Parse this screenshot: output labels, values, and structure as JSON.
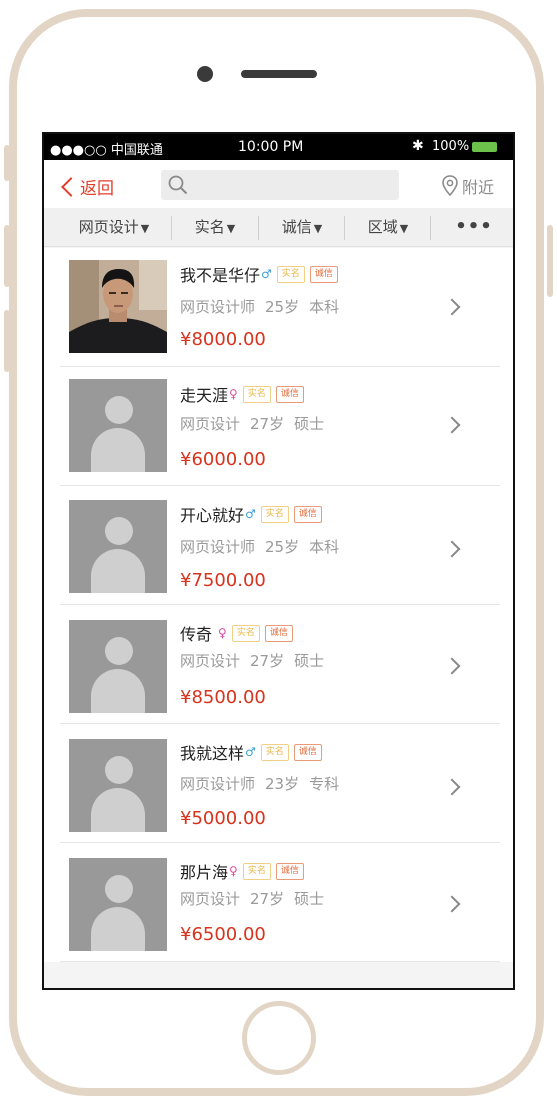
{
  "status_bar": {
    "carrier": "●●●○○ 中国联通",
    "time": "10:00 PM",
    "bluetooth": "bluetooth-icon",
    "battery": "100%",
    "battery_level": 1.0,
    "battery_color": "#6cc24a"
  },
  "nav": {
    "back_label": "返回",
    "search_placeholder": "",
    "nearby_label": "附近"
  },
  "filters": [
    {
      "label": "网页设计"
    },
    {
      "label": "实名"
    },
    {
      "label": "诚信"
    },
    {
      "label": "区域"
    }
  ],
  "more_label": "•••",
  "badges": {
    "real": "实名",
    "credit": "诚信"
  },
  "items": [
    {
      "name": "我不是华仔",
      "gender": "♂",
      "gender_type": "male",
      "job": "网页设计师",
      "age": "25岁",
      "edu": "本科",
      "price": "¥8000.00",
      "avatar": "photo"
    },
    {
      "name": "走天涯",
      "gender": "♀",
      "gender_type": "female",
      "job": "网页设计",
      "age": "27岁",
      "edu": "硕士",
      "price": "¥6000.00",
      "avatar": "placeholder"
    },
    {
      "name": "开心就好",
      "gender": "♂",
      "gender_type": "male",
      "job": "网页设计师",
      "age": "25岁",
      "edu": "本科",
      "price": "¥7500.00",
      "avatar": "placeholder"
    },
    {
      "name": "传奇",
      "gender": "♀",
      "gender_type": "female",
      "job": "网页设计",
      "age": "27岁",
      "edu": "硕士",
      "price": "¥8500.00",
      "avatar": "placeholder"
    },
    {
      "name": "我就这样",
      "gender": "♂",
      "gender_type": "male",
      "job": "网页设计师",
      "age": "23岁",
      "edu": "专科",
      "price": "¥5000.00",
      "avatar": "placeholder"
    },
    {
      "name": "那片海",
      "gender": "♀",
      "gender_type": "female",
      "job": "网页设计",
      "age": "27岁",
      "edu": "硕士",
      "price": "¥6500.00",
      "avatar": "placeholder"
    }
  ],
  "colors": {
    "accent": "#e33e2b",
    "price": "#d8331c",
    "frame": "#e3d5c5"
  }
}
